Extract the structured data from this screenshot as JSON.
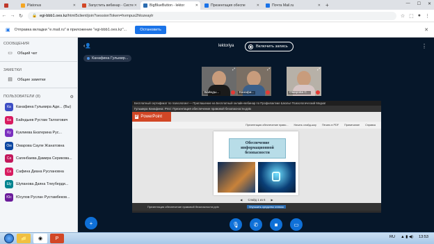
{
  "browser": {
    "tabs": [
      {
        "label": "",
        "color": "#c0392b",
        "active": false
      },
      {
        "label": "Platonus",
        "color": "#f5a623",
        "active": false
      },
      {
        "label": "Запустить вебинар - Систе",
        "color": "#d24726",
        "active": false
      },
      {
        "label": "BigBlueButton - lektor",
        "color": "#2b6cb0",
        "active": true
      },
      {
        "label": "Презентация обеспе",
        "color": "#1a73e8",
        "active": false
      },
      {
        "label": "Почта Mail.ru",
        "color": "#1a73e8",
        "active": false
      }
    ],
    "new_tab": "+",
    "url_host": "egi-bbb1.oes.kz",
    "url_path": "/html5client/join?sessionToken=hvmpus2hlozeaylr",
    "infobar_message": "Отправка вкладки \"e.mail.ru\" в приложение \"egi-bbb1.oes.kz\"...",
    "infobar_button": "Остановить",
    "infobar_close": "✕"
  },
  "sidebar": {
    "messages_header": "СООБЩЕНИЯ",
    "public_chat": "Общий чат",
    "notes_header": "ЗАМЕТКИ",
    "shared_notes": "Общие заметки",
    "users_header": "ПОЛЬЗОВАТЕЛИ (8)",
    "users": [
      {
        "initials": "Ка",
        "name": "Канафина Гульмира Ади... (Вы)",
        "color": "#3d4ec4"
      },
      {
        "initials": "Ба",
        "name": "Байндыев Рустам Талгатович",
        "color": "#d81b60"
      },
      {
        "initials": "Ку",
        "name": "Куклиева Екатерина Рус...",
        "color": "#7b2fbf"
      },
      {
        "initials": "Ом",
        "name": "Омарова Сауле Жанатовна",
        "color": "#0d47a1"
      },
      {
        "initials": "Са",
        "name": "Сагинбаева Дамира Серикова...",
        "color": "#c2185b"
      },
      {
        "initials": "Са",
        "name": "Сафина Диана Руслановна",
        "color": "#d81b60"
      },
      {
        "initials": "Шу",
        "name": "Шупанова Даяна Тлеуберди...",
        "color": "#00838f"
      },
      {
        "initials": "Юс",
        "name": "Юсупов Руслан Рустамбеков...",
        "color": "#6a1b9a"
      }
    ]
  },
  "meeting": {
    "title": "lektoriya",
    "record_label": "Включить запись",
    "presenter": "Канафина Гульмир...",
    "videos": [
      {
        "name": "Байнды...",
        "bg": "#6b6b6b",
        "shirt": "#1a1a1a"
      },
      {
        "name": "Канафи...",
        "bg": "#7a6f64",
        "shirt": "#3a5f8a"
      },
      {
        "name": "Омарова С...",
        "bg": "#b7b1a8",
        "shirt": "#d8c6c6"
      }
    ]
  },
  "presentation": {
    "window_title": "Гульмира Канафина: Prez: Презентация обеспечение правовой безопасности.pptx",
    "header_strip": "Бесплатный сертификат по психологии! — Приглашение на Бесплатный онлайн-вебинар по Профилактике Школы! Психологический Медиа!",
    "app_name": "PowerPoint",
    "tools": [
      "Презентация обеспечение право...",
      "Начать слайд-шоу",
      "Печать в PDF",
      "Примечание",
      "Справка"
    ],
    "slide_title": "Обеспечение информационной безопасности",
    "slide_nav": "Слайд 1 из 6",
    "status_left": "Презентация обеспечение правовой безопасности.pptx",
    "status_right": "Улучшить средство чтения"
  },
  "controls": [
    "+",
    "mic",
    "phone",
    "camera",
    "screen"
  ],
  "taskbar": {
    "lang": "RU",
    "time": "13:53"
  }
}
